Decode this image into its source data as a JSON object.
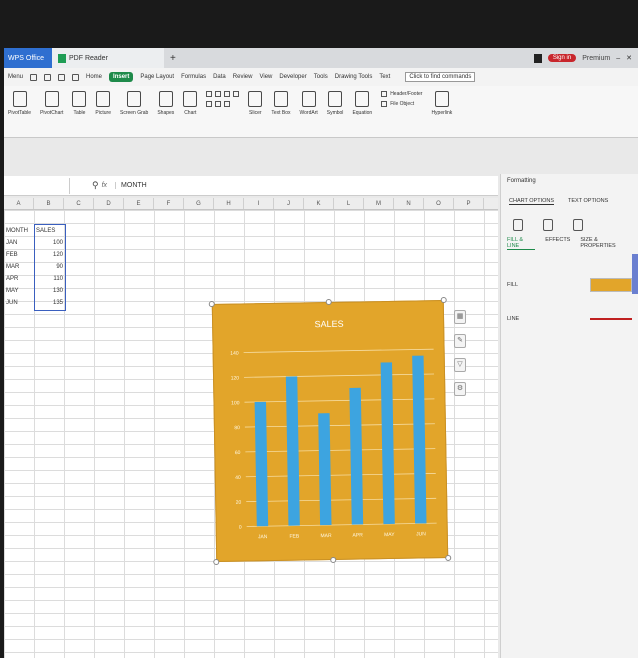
{
  "titlebar": {
    "app_label": "WPS Office",
    "doc_tab": "PDF Reader",
    "signin_label": "Sign in",
    "premium_label": "Premium"
  },
  "menu": {
    "menu_label": "Menu",
    "tabs": [
      "Home",
      "Insert",
      "Page Layout",
      "Formulas",
      "Data",
      "Review",
      "View",
      "Developer",
      "Tools",
      "Drawing Tools",
      "Text"
    ],
    "active_tab": "Insert",
    "search_label": "Click to find commands"
  },
  "ribbon": {
    "buttons": [
      "PivotTable",
      "PivotChart",
      "Table",
      "Picture",
      "Screen Grab",
      "Shapes",
      "Chart",
      "Slicer",
      "Text Box",
      "WordArt",
      "Symbol",
      "Equation",
      "Header/Footer",
      "File Object",
      "Hyperlink"
    ]
  },
  "formula_bar": {
    "fx": "fx",
    "value": "MONTH"
  },
  "columns": [
    "A",
    "B",
    "C",
    "D",
    "E",
    "F",
    "G",
    "H",
    "I",
    "J",
    "K",
    "L",
    "M",
    "N",
    "O",
    "P"
  ],
  "sheet": {
    "header": [
      "MONTH",
      "SALES"
    ],
    "rows": [
      [
        "JAN",
        "100"
      ],
      [
        "FEB",
        "120"
      ],
      [
        "MAR",
        "90"
      ],
      [
        "APR",
        "110"
      ],
      [
        "MAY",
        "130"
      ],
      [
        "JUN",
        "135"
      ]
    ]
  },
  "chart_data": {
    "type": "bar",
    "title": "SALES",
    "categories": [
      "JAN",
      "FEB",
      "MAR",
      "APR",
      "MAY",
      "JUN"
    ],
    "values": [
      100,
      120,
      90,
      110,
      130,
      135
    ],
    "ylim": [
      0,
      140
    ],
    "yticks": [
      0,
      20,
      40,
      60,
      80,
      100,
      120,
      140
    ],
    "grid": true,
    "bar_color": "#3da4e0",
    "background_color": "#e2a52a"
  },
  "panel": {
    "title": "Formatting",
    "tabs": [
      "CHART OPTIONS",
      "TEXT OPTIONS"
    ],
    "subtabs": [
      "FILL & LINE",
      "EFFECTS",
      "SIZE & PROPERTIES"
    ],
    "fill_label": "FILL",
    "line_label": "LINE",
    "fill_color": "#e2a52a",
    "line_color": "#c02020"
  }
}
